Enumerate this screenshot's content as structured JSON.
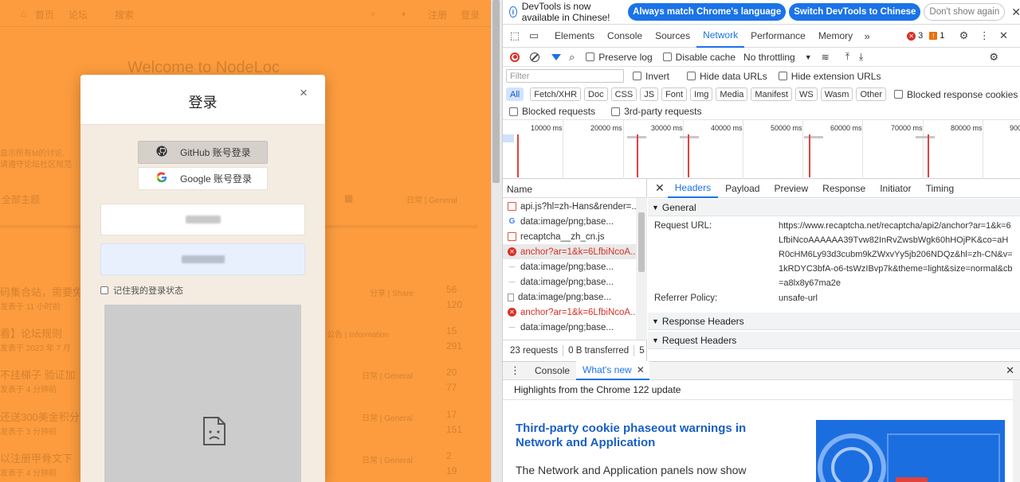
{
  "site": {
    "ghost_nav": [
      "首页",
      "论坛",
      "搜索",
      "注册",
      "登录"
    ],
    "ghost_welcome": "Welcome to NodeLoc",
    "ghost_side": [
      "显示所有M的讨论,",
      "请遵守论坛社区规范"
    ],
    "ghost_filters": [
      "全部主题",
      "日常 | General"
    ],
    "ghost_topics": [
      {
        "title": "码集合站，需要免",
        "meta": "发表于 11 小时前",
        "tag": "分享 | Share",
        "count": "56",
        "views": "120"
      },
      {
        "title": "看】论坛规则",
        "meta": "发表于 2023 年 7 月",
        "tag": "公告 | Information",
        "count": "15",
        "views": "291"
      },
      {
        "title": "不挂梯子 验证加",
        "meta": "发表于 4 分钟前",
        "tag": "日常 | General",
        "count": "20",
        "views": "77"
      },
      {
        "title": "还送300美金积分",
        "meta": "发表于 3 分钟前",
        "tag": "日常 | General",
        "count": "17",
        "views": "151"
      },
      {
        "title": "以注册甲骨文下",
        "meta": "发表于 4 分钟前",
        "tag": "日常 | General",
        "count": "2",
        "views": "19"
      }
    ]
  },
  "modal": {
    "title": "登录",
    "close_glyph": "×",
    "github_label": "GitHub 账号登录",
    "google_label": "Google 账号登录",
    "remember_label": "记住我的登录状态"
  },
  "devtools": {
    "infobar": {
      "text": "DevTools is now available in Chinese!",
      "btn_match": "Always match Chrome's language",
      "btn_switch": "Switch DevTools to Chinese",
      "btn_dismiss": "Don't show again"
    },
    "tabs": [
      "Elements",
      "Console",
      "Sources",
      "Network",
      "Performance",
      "Memory"
    ],
    "active_tab": "Network",
    "error_count": "3",
    "warning_count": "1",
    "toolbar": {
      "preserve_log": "Preserve log",
      "disable_cache": "Disable cache",
      "throttling": "No throttling"
    },
    "filter": {
      "placeholder": "Filter",
      "invert": "Invert",
      "hide_data": "Hide data URLs",
      "hide_ext": "Hide extension URLs"
    },
    "type_filters": [
      "All",
      "Fetch/XHR",
      "Doc",
      "CSS",
      "JS",
      "Font",
      "Img",
      "Media",
      "Manifest",
      "WS",
      "Wasm",
      "Other"
    ],
    "blocked_cookies": "Blocked response cookies",
    "blocked_requests": "Blocked requests",
    "third_party": "3rd-party requests",
    "timeline_labels": [
      "10000 ms",
      "20000 ms",
      "30000 ms",
      "40000 ms",
      "50000 ms",
      "60000 ms",
      "70000 ms",
      "80000 ms",
      "900"
    ],
    "name_header": "Name",
    "requests": [
      {
        "name": "api.js?hl=zh-Hans&render=...",
        "icon": "script-icon",
        "error": false
      },
      {
        "name": "data:image/png;base...",
        "icon": "google-icon",
        "error": false
      },
      {
        "name": "recaptcha__zh_cn.js",
        "icon": "script-icon",
        "error": false
      },
      {
        "name": "anchor?ar=1&k=6LfbiNcoA...",
        "icon": "error-icon",
        "error": true
      },
      {
        "name": "data:image/png;base...",
        "icon": "dash-icon",
        "error": false
      },
      {
        "name": "data:image/png;base...",
        "icon": "dash-icon",
        "error": false
      },
      {
        "name": "data:image/png;base...",
        "icon": "document-icon",
        "error": false
      },
      {
        "name": "anchor?ar=1&k=6LfbiNcoA...",
        "icon": "error-icon",
        "error": true
      },
      {
        "name": "data:image/png;base...",
        "icon": "dash-icon",
        "error": false
      }
    ],
    "req_status": {
      "requests": "23 requests",
      "transferred": "0 B transferred",
      "more": "5"
    },
    "detail_tabs": [
      "Headers",
      "Payload",
      "Preview",
      "Response",
      "Initiator",
      "Timing"
    ],
    "general_label": "General",
    "request_url_key": "Request URL:",
    "request_url": "https://www.recaptcha.net/recaptcha/api2/anchor?ar=1&k=6LfbiNcoAAAAAA39Tvw82InRvZwsbWgk60hHOjPK&co=aHR0cHM6Ly93d3cubm9kZWxvYy5jb206NDQz&hl=zh-CN&v=1kRDYC3bfA-o6-tsWzIBvp7k&theme=light&size=normal&cb=a8lx8y67ma2e",
    "referrer_key": "Referrer Policy:",
    "referrer_value": "unsafe-url",
    "response_headers_label": "Response Headers",
    "request_headers_label": "Request Headers",
    "drawer_tabs": [
      "Console",
      "What's new"
    ],
    "highlights": "Highlights from the Chrome 122 update",
    "news_title": "Third-party cookie phaseout warnings in Network and Application",
    "news_body": "The Network and Application panels now show you"
  },
  "colors": {
    "site_bg": "#fc9c3e",
    "accent": "#1a73e8",
    "error": "#d93025"
  }
}
